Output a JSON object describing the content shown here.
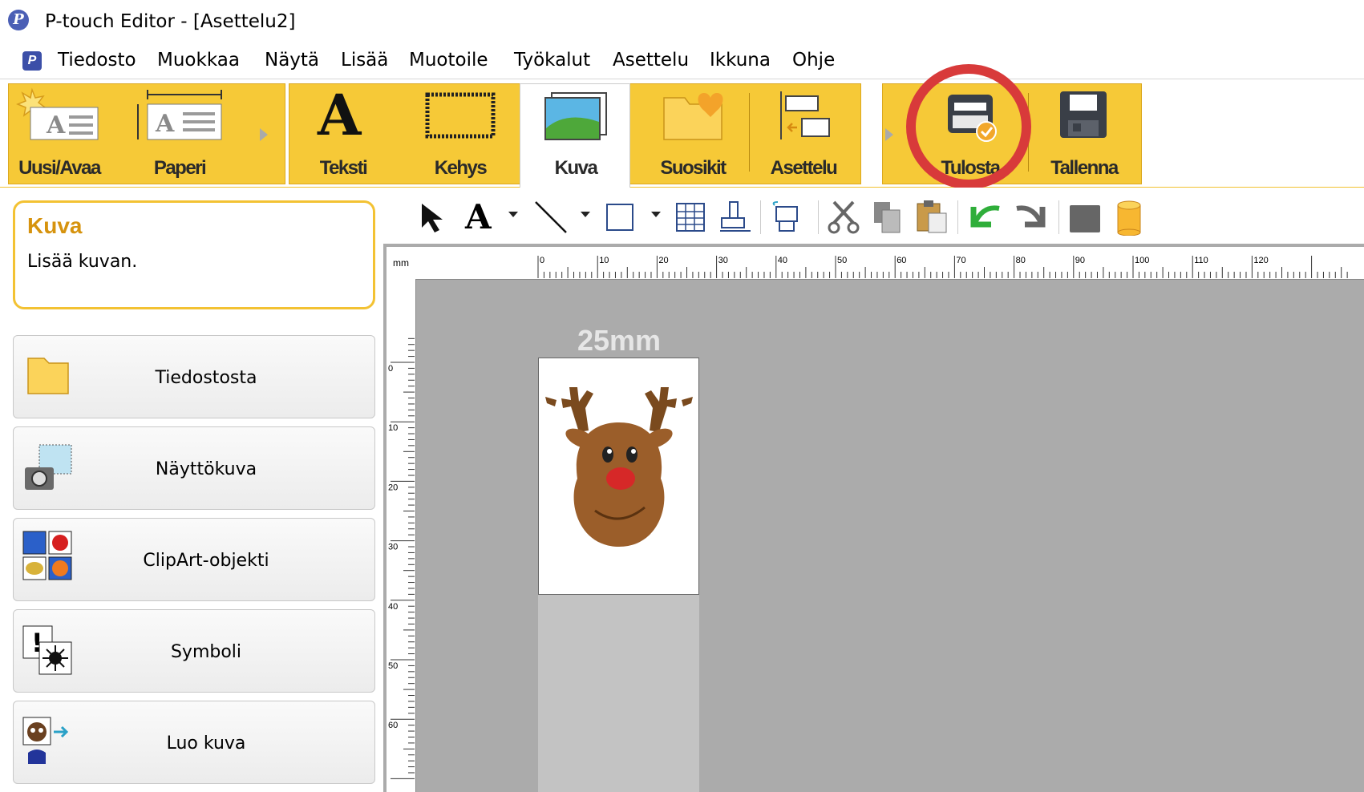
{
  "window": {
    "title": "P-touch Editor - [Asettelu2]"
  },
  "menu": {
    "items": [
      "Tiedosto",
      "Muokkaa",
      "Näytä",
      "Lisää",
      "Muotoile",
      "Työkalut",
      "Asettelu",
      "Ikkuna",
      "Ohje"
    ]
  },
  "ribbon": {
    "new_open": "Uusi/Avaa",
    "paper": "Paperi",
    "text": "Teksti",
    "frame": "Kehys",
    "image": "Kuva",
    "favorites": "Suosikit",
    "layout": "Asettelu",
    "print": "Tulosta",
    "save": "Tallenna",
    "active_tab": "Kuva"
  },
  "panel": {
    "title": "Kuva",
    "description": "Lisää kuvan.",
    "buttons": [
      "Tiedostosta",
      "Näyttökuva",
      "ClipArt-objekti",
      "Symboli",
      "Luo kuva"
    ]
  },
  "editor": {
    "unit": "mm",
    "label_width": "25mm",
    "hruler_ticks": [
      "0",
      "10",
      "20",
      "30",
      "40",
      "50",
      "60",
      "70",
      "80",
      "90",
      "100",
      "110",
      "120"
    ],
    "vruler_ticks": [
      "0",
      "10",
      "20",
      "30",
      "40",
      "50",
      "60"
    ]
  },
  "colors": {
    "ribbon": "#f6c937",
    "accent_text": "#d6930e",
    "highlight": "#d83a3a",
    "canvas_bg": "#ababab"
  }
}
